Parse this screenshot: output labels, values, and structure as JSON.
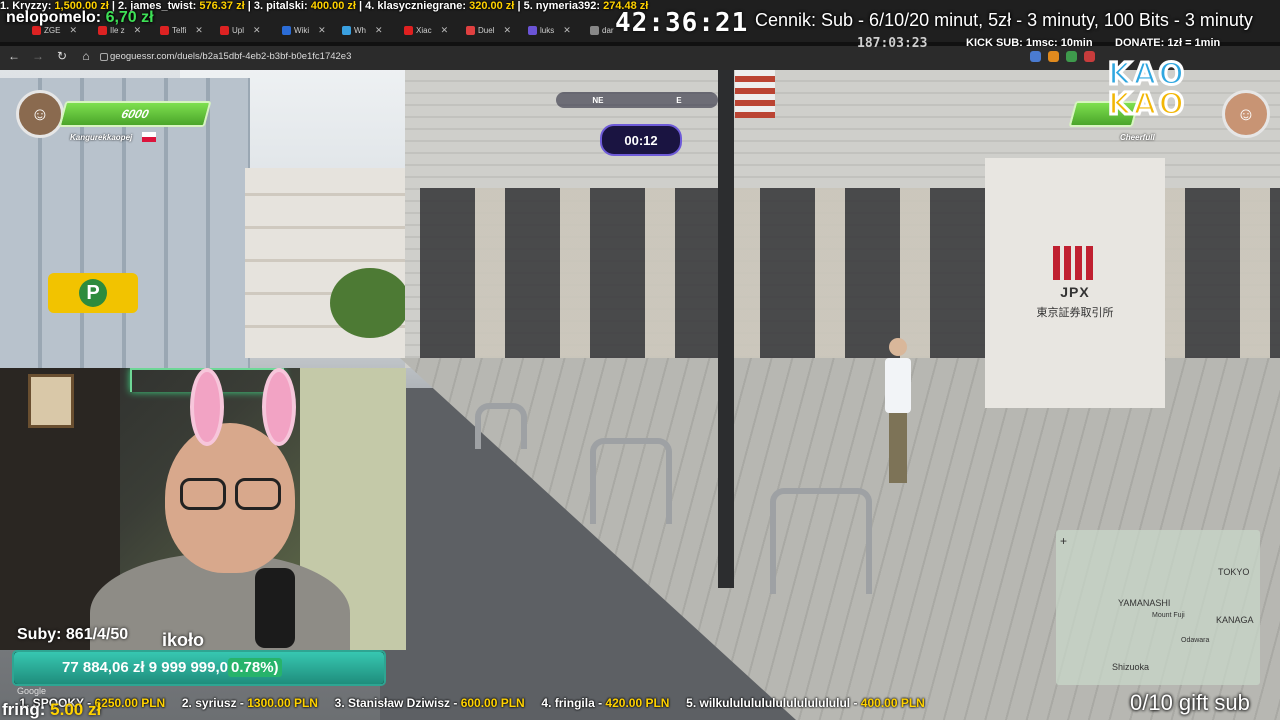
{
  "top_donors": {
    "line": [
      {
        "rank": "1. Kryzzy: ",
        "amount": "1,500.00 zł"
      },
      {
        "rank": "| 2. james_twist: ",
        "amount": "576.37 zł"
      },
      {
        "rank": "| 3. pitalski: ",
        "amount": "400.00 zł"
      },
      {
        "rank": "| 4. klasyczniegrane: ",
        "amount": "320.00 zł"
      },
      {
        "rank": "| 5. nymeria392: ",
        "amount": "274.48 zł"
      }
    ]
  },
  "latest": {
    "name": "nelopomelo: ",
    "amount": "6,70 zł"
  },
  "stream": {
    "clock": "42:36:21",
    "cennik": "Cennik: Sub - 6/10/20 minut, 5zł - 3 minuty, 100 Bits - 3 minuty",
    "clock2": "187:03:23",
    "kick_sub": "KICK SUB: 1msc: 10min",
    "donate": "DONATE: 1zł = 1min"
  },
  "browser": {
    "tabs": [
      "ZGE",
      "Ile z",
      "Telfi",
      "Upl",
      "Wiki",
      "Wh",
      "Xiac",
      "Duel",
      "luks",
      "dar"
    ],
    "url": "geoguessr.com/duels/b2a15dbf-4eb2-b3bf-b0e1fc1742e3"
  },
  "game": {
    "player_left": {
      "name": "Kangurekkaopej",
      "hp": "6000"
    },
    "player_right": {
      "name": "Cheerfull"
    },
    "timer": "00:12",
    "compass": [
      "NE",
      "E"
    ],
    "sign_name": "JPX",
    "sign_sub": "東京証券取引所",
    "parking": "P",
    "minimap_labels": [
      "TOKYO",
      "YAMANASHI",
      "Mount Fuji",
      "KANAGA",
      "Shizuoka",
      "Odawara"
    ]
  },
  "overlay": {
    "brand_line1": "KAO",
    "brand_line2": "KAO"
  },
  "sub_goal": {
    "suby": "Suby: 861/4/50",
    "koko": "ikoło",
    "current": "77 884,06 zł",
    "target": "9 999 999,0",
    "percent_label": "0.78%)",
    "percent": 0.78,
    "google": "Google"
  },
  "ticker": [
    {
      "label": "1. SPOOKY - ",
      "value": "6250.00 PLN"
    },
    {
      "label": "2. syriusz - ",
      "value": "1300.00 PLN"
    },
    {
      "label": "3. Stanisław Dziwisz - ",
      "value": "600.00 PLN"
    },
    {
      "label": "4. fringila - ",
      "value": "420.00 PLN"
    },
    {
      "label": "5. wilkulululululululululululul - ",
      "value": "400.00 PLN"
    }
  ],
  "fring": {
    "name": "fring: ",
    "amount": "5.00 zł"
  },
  "gift_sub": "0/10 gift sub",
  "colors": {
    "accent_yellow": "#ffd200",
    "hp_green": "#4aa52a",
    "timer_purple": "#6e5bd8",
    "goal_teal": "#2ea592"
  }
}
